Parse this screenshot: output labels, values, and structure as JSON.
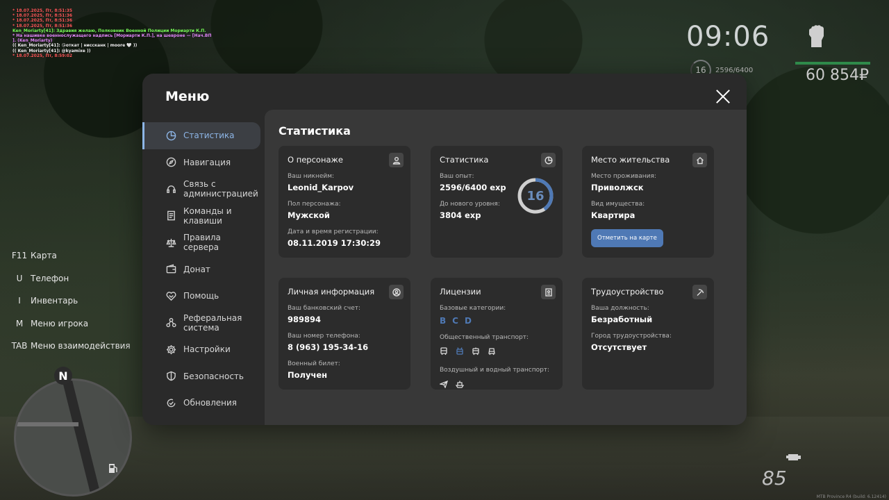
{
  "chat": [
    {
      "text": "* 18.07.2025, Пт, 8:51:35",
      "color": "red"
    },
    {
      "text": "* 18.07.2025, Пт, 8:51:36",
      "color": "red"
    },
    {
      "text": "* 18.07.2025, Пт, 8:51:36",
      "color": "red"
    },
    {
      "text": "* 18.07.2025, Пт, 8:51:36",
      "color": "red"
    },
    {
      "text": "Ken_Moriarty[41]: Здравия желаю, Полковник Военной Полиции Мориарти К.П.",
      "color": "green"
    },
    {
      "text": "* На нашивке военнослужащего надпись [Мориарти К.П.], на шевроне — [Нач.ВП",
      "color": "pink"
    },
    {
      "text": "]. (Ken_Moriarty)",
      "color": "pink"
    },
    {
      "text": "(( Ken_Moriarty[41]: 😘откат | ниссканк | moore 🤍 ))",
      "color": "white"
    },
    {
      "text": "(( Ken_Moriarty[41]: @kyamixe ))",
      "color": "white"
    },
    {
      "text": "* 18.07.2025, Пт, 8:59:02",
      "color": "red"
    }
  ],
  "hud": {
    "time": "09:06",
    "level": "16",
    "exp": "2596/6400",
    "money": "60 854₽",
    "speed": "85",
    "build": "MTB Province R4 (build: 6.12414)"
  },
  "keybinds": [
    {
      "key": "F11",
      "label": "Карта"
    },
    {
      "key": "U",
      "label": "Телефон"
    },
    {
      "key": "I",
      "label": "Инвентарь"
    },
    {
      "key": "M",
      "label": "Меню игрока"
    },
    {
      "key": "TAB",
      "label": "Меню взаимодействия"
    }
  ],
  "minimap": {
    "north": "N"
  },
  "menu": {
    "title": "Меню",
    "sidebar": [
      {
        "label": "Статистика",
        "icon": "chart-pie-icon",
        "active": true
      },
      {
        "label": "Навигация",
        "icon": "compass-icon"
      },
      {
        "label": "Связь с администрацией",
        "icon": "headset-icon"
      },
      {
        "label": "Команды и клавиши",
        "icon": "document-icon"
      },
      {
        "label": "Правила сервера",
        "icon": "scales-icon"
      },
      {
        "label": "Донат",
        "icon": "wallet-icon"
      },
      {
        "label": "Помощь",
        "icon": "handshake-icon"
      },
      {
        "label": "Реферальная система",
        "icon": "network-icon"
      },
      {
        "label": "Настройки",
        "icon": "gear-icon"
      },
      {
        "label": "Безопасность",
        "icon": "shield-icon"
      },
      {
        "label": "Обновления",
        "icon": "refresh-check-icon"
      }
    ],
    "content_title": "Статистика",
    "cards": {
      "character": {
        "title": "О персонаже",
        "nickname_label": "Ваш никнейм:",
        "nickname": "Leonid_Karpov",
        "gender_label": "Пол персонажа:",
        "gender": "Мужской",
        "reg_label": "Дата и время регистрации:",
        "reg": "08.11.2019 17:30:29"
      },
      "stats": {
        "title": "Статистика",
        "exp_label": "Ваш опыт:",
        "exp": "2596/6400 exp",
        "next_label": "До нового уровня:",
        "next": "3804 exp",
        "level": "16",
        "progress": 0.4056
      },
      "residence": {
        "title": "Место жительства",
        "place_label": "Место проживания:",
        "place": "Приволжск",
        "property_label": "Вид имущества:",
        "property": "Квартира",
        "button": "Отметить на карте"
      },
      "personal": {
        "title": "Личная информация",
        "bank_label": "Ваш банковский счет:",
        "bank": "989894",
        "phone_label": "Ваш номер телефона:",
        "phone": "8 (963) 195-34-16",
        "military_label": "Военный билет:",
        "military": "Получен"
      },
      "licenses": {
        "title": "Лицензии",
        "base_label": "Базовые категории:",
        "categories": [
          "B",
          "C",
          "D"
        ],
        "public_label": "Общественный транспорт:",
        "air_label": "Воздушный и водный транспорт:"
      },
      "employment": {
        "title": "Трудоустройство",
        "position_label": "Ваша должность:",
        "position": "Безработный",
        "city_label": "Город трудоустройства:",
        "city": "Отсутствует"
      }
    }
  }
}
